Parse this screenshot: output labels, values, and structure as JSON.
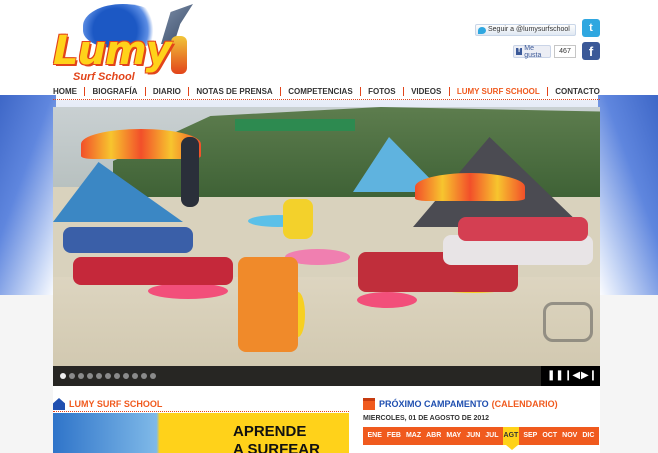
{
  "logo": {
    "brand": "Lumy",
    "tagline": "Surf School"
  },
  "social": {
    "twitter_follow": "Seguir a @lumysurfschool",
    "facebook_like": "Me gusta",
    "facebook_count": "467"
  },
  "nav": {
    "items": [
      {
        "label": "HOME"
      },
      {
        "label": "BIOGRAFÍA"
      },
      {
        "label": "DIARIO"
      },
      {
        "label": "NOTAS DE PRENSA"
      },
      {
        "label": "COMPETENCIAS"
      },
      {
        "label": "FOTOS"
      },
      {
        "label": "VIDEOS"
      },
      {
        "label": "LUMY SURF SCHOOL"
      },
      {
        "label": "CONTACTO"
      }
    ],
    "active_index": 7
  },
  "slider": {
    "total_slides": 11,
    "current_slide": 1
  },
  "left_section": {
    "title": "LUMY SURF SCHOOL",
    "promo_line1": "APRENDE",
    "promo_line2": "A SURFEAR"
  },
  "right_section": {
    "title": "PRÓXIMO CAMPAMENTO",
    "link": "(CALENDARIO)",
    "date": "MIERCOLES, 01 DE AGOSTO DE 2012",
    "months": [
      "ENE",
      "FEB",
      "MAZ",
      "ABR",
      "MAY",
      "JUN",
      "JUL",
      "AGT",
      "SEP",
      "OCT",
      "NOV",
      "DIC"
    ],
    "active_month": "AGT"
  },
  "colors": {
    "accent": "#f05a1e",
    "brand_blue": "#1f4fb0",
    "highlight": "#ffd21a"
  }
}
